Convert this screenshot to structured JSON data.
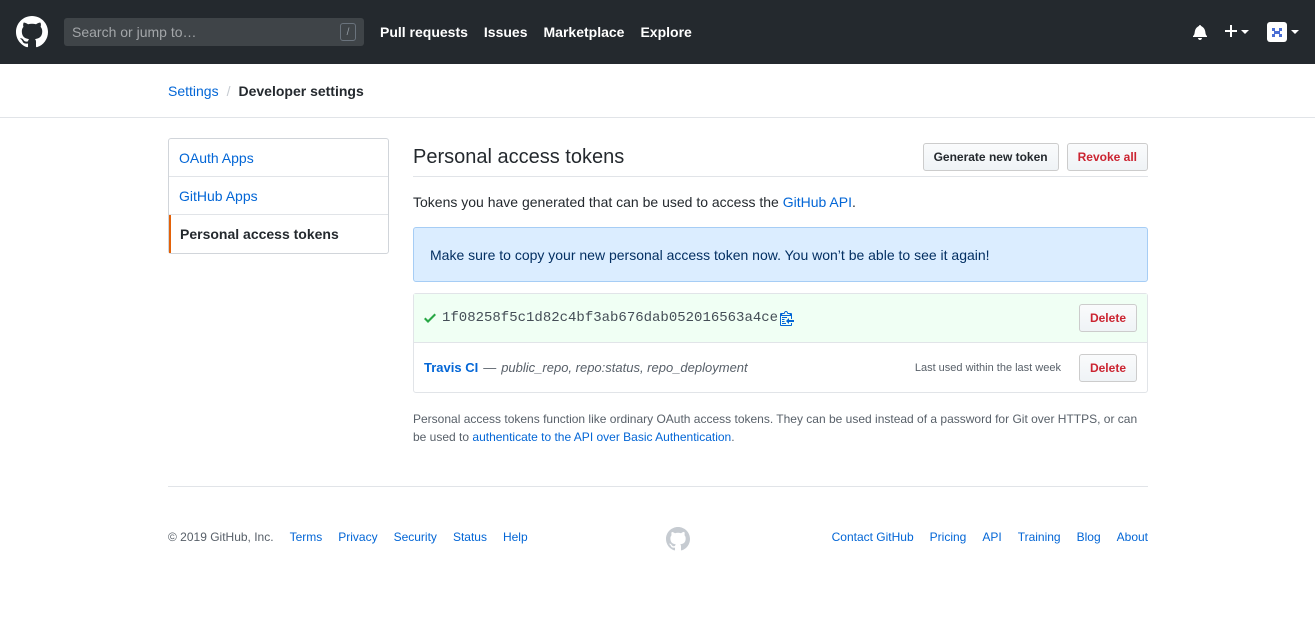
{
  "header": {
    "search_placeholder": "Search or jump to…",
    "search_shortcut": "/",
    "nav": [
      "Pull requests",
      "Issues",
      "Marketplace",
      "Explore"
    ]
  },
  "breadcrumb": {
    "parent": "Settings",
    "separator": "/",
    "current": "Developer settings"
  },
  "sidebar": {
    "items": [
      {
        "label": "OAuth Apps",
        "active": false
      },
      {
        "label": "GitHub Apps",
        "active": false
      },
      {
        "label": "Personal access tokens",
        "active": true
      }
    ]
  },
  "main": {
    "title": "Personal access tokens",
    "generate_label": "Generate new token",
    "revoke_label": "Revoke all",
    "description_prefix": "Tokens you have generated that can be used to access the ",
    "description_link": "GitHub API",
    "description_suffix": ".",
    "flash": "Make sure to copy your new personal access token now. You won’t be able to see it again!",
    "tokens": [
      {
        "value": "1f08258f5c1d82c4bf3ab676dab052016563a4ce",
        "delete_label": "Delete"
      },
      {
        "name": "Travis CI",
        "dash": "—",
        "scopes": "public_repo, repo:status, repo_deployment",
        "last_used": "Last used within the last week",
        "delete_label": "Delete"
      }
    ],
    "note_text": "Personal access tokens function like ordinary OAuth access tokens. They can be used instead of a password for Git over HTTPS, or can be used to ",
    "note_link": "authenticate to the API over Basic Authentication",
    "note_suffix": "."
  },
  "footer": {
    "copyright": "© 2019 GitHub, Inc.",
    "left_links": [
      "Terms",
      "Privacy",
      "Security",
      "Status",
      "Help"
    ],
    "right_links": [
      "Contact GitHub",
      "Pricing",
      "API",
      "Training",
      "Blog",
      "About"
    ]
  },
  "colors": {
    "header_bg": "#24292e",
    "link": "#0366d6",
    "danger": "#cb2431",
    "success": "#28a745",
    "flash_bg": "#dbedff",
    "active_marker": "#e36209"
  },
  "icons": [
    "github-logo-icon",
    "bell-icon",
    "plus-icon",
    "avatar-icon",
    "check-icon",
    "clipboard-icon"
  ]
}
